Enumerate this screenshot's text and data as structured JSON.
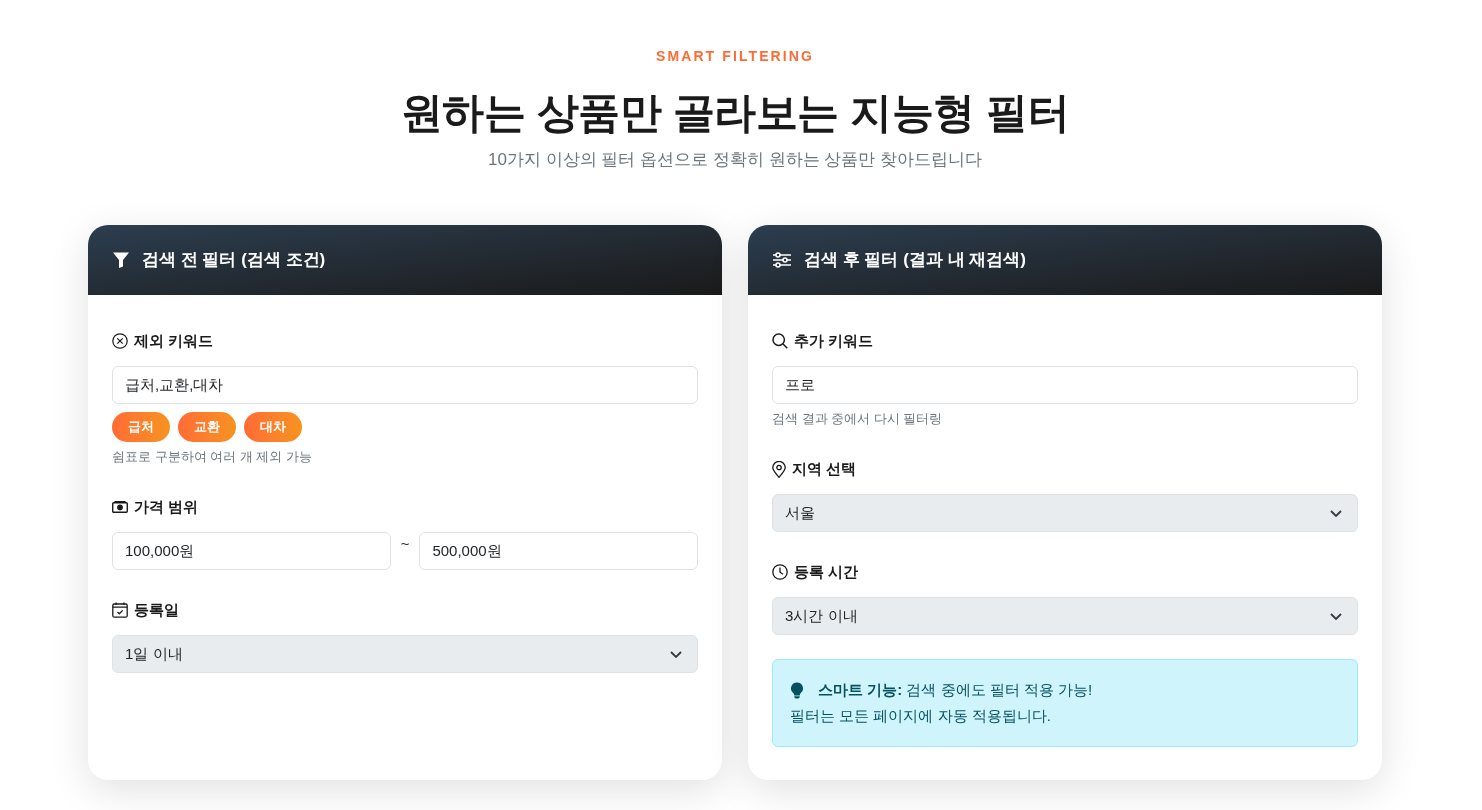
{
  "header": {
    "eyebrow": "SMART FILTERING",
    "title": "원하는 상품만 골라보는 지능형 필터",
    "subtitle": "10가지 이상의 필터 옵션으로 정확히 원하는 상품만 찾아드립니다"
  },
  "panels": [
    {
      "title": "검색 전 필터 (검색 조건)",
      "fields": [
        {
          "kind": "text",
          "label": "제외 키워드",
          "value": "급처,교환,대차",
          "tags": [
            "급처",
            "교환",
            "대차"
          ],
          "help": "쉼표로 구분하여 여러 개 제외 가능"
        },
        {
          "kind": "range",
          "label": "가격 범위",
          "min_value": "100,000원",
          "separator": "~",
          "max_value": "500,000원"
        },
        {
          "kind": "select",
          "label": "등록일",
          "value": "1일 이내"
        }
      ]
    },
    {
      "title": "검색 후 필터 (결과 내 재검색)",
      "fields": [
        {
          "kind": "text",
          "label": "추가 키워드",
          "value": "프로",
          "help": "검색 결과 중에서 다시 필터링"
        },
        {
          "kind": "select",
          "label": "지역 선택",
          "value": "서울"
        },
        {
          "kind": "select",
          "label": "등록 시간",
          "value": "3시간 이내"
        },
        {
          "kind": "note",
          "lines": [
            "**스마트 기능:** 검색 중에도 필터 적용 가능!",
            "필터는 모든 페이지에 자동 적용됩니다."
          ]
        }
      ]
    }
  ]
}
